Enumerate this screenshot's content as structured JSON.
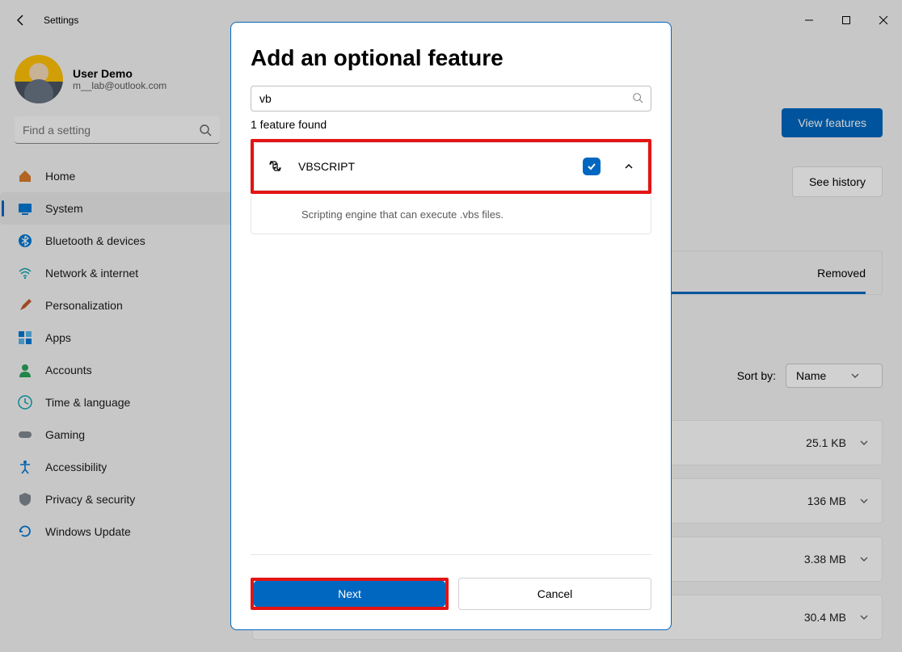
{
  "window": {
    "title": "Settings"
  },
  "user": {
    "name": "User Demo",
    "email": "m__lab@outlook.com"
  },
  "search": {
    "placeholder": "Find a setting"
  },
  "nav": {
    "items": [
      {
        "label": "Home"
      },
      {
        "label": "System"
      },
      {
        "label": "Bluetooth & devices"
      },
      {
        "label": "Network & internet"
      },
      {
        "label": "Personalization"
      },
      {
        "label": "Apps"
      },
      {
        "label": "Accounts"
      },
      {
        "label": "Time & language"
      },
      {
        "label": "Gaming"
      },
      {
        "label": "Accessibility"
      },
      {
        "label": "Privacy & security"
      },
      {
        "label": "Windows Update"
      }
    ]
  },
  "main": {
    "view_features": "View features",
    "see_history": "See history",
    "removed": "Removed",
    "sort_label": "Sort by:",
    "sort_value": "Name",
    "sizes": [
      "25.1 KB",
      "136 MB",
      "3.38 MB",
      "30.4 MB"
    ]
  },
  "dialog": {
    "title": "Add an optional feature",
    "search_value": "vb",
    "found": "1 feature found",
    "feature_name": "VBSCRIPT",
    "feature_desc": "Scripting engine that can execute .vbs files.",
    "next": "Next",
    "cancel": "Cancel"
  }
}
